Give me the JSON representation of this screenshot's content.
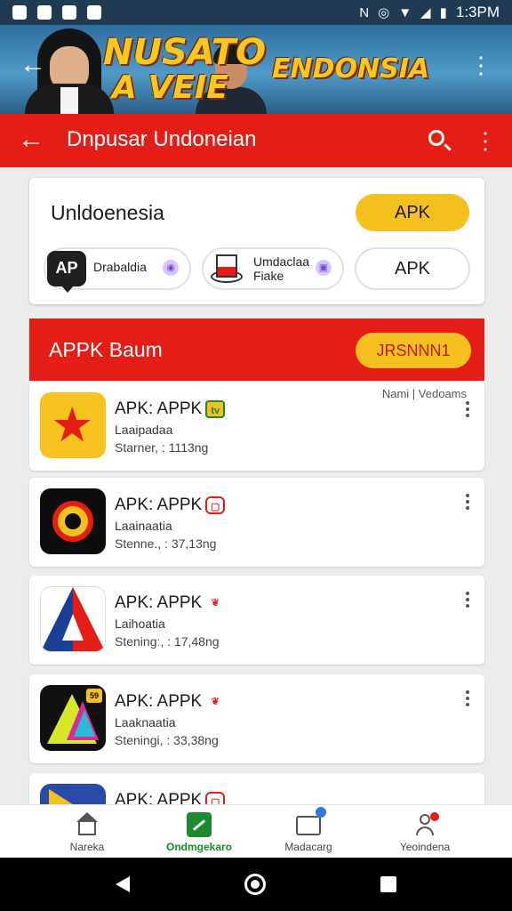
{
  "status_bar": {
    "time": "1:3PM",
    "left_icons": [
      "notification-icon",
      "notification-icon",
      "notification-icon",
      "notification-icon"
    ],
    "right_icons": [
      "nfc-icon",
      "alarm-icon",
      "wifi-icon",
      "signal-icon",
      "battery-icon"
    ]
  },
  "banner": {
    "title_line1": "NUSATO",
    "title_line2": "A VEIE",
    "title_right": "ENDONSIA"
  },
  "app_bar": {
    "title": "Dnpusar Undoneian",
    "color": "#e41e16"
  },
  "info_card": {
    "title": "Unldoenesia",
    "apk_button": "APK",
    "chips": [
      {
        "icon_text": "AP",
        "label": "Drabaldia"
      },
      {
        "label_line1": "Umdaclaa",
        "label_line2": "Fiake"
      },
      {
        "label": "APK"
      }
    ]
  },
  "section": {
    "title": "APPK Baum",
    "button": "JRSNNN1",
    "sort_label": "Nami | Vedoams"
  },
  "apps": [
    {
      "name": "APK: APPK",
      "category": "Laaipadaa",
      "meta": "Starner, : 1113ng"
    },
    {
      "name": "APK: APPK",
      "category": "Laainaatia",
      "meta": "Stenne., : 37,13ng"
    },
    {
      "name": "APK: APPK",
      "category": "Laihoatia",
      "meta": "Steningː, : 17,48ng"
    },
    {
      "name": "APK: APPK",
      "category": "Laaknaatia",
      "meta": "Steningi, : 33,38ng"
    },
    {
      "name": "APK: APPK"
    }
  ],
  "bottom_nav": [
    {
      "label": "Nareka"
    },
    {
      "label": "Ondmgekaro"
    },
    {
      "label": "Madacarg"
    },
    {
      "label": "Yeoindena"
    }
  ],
  "colors": {
    "primary_red": "#e41e16",
    "accent_yellow": "#f4c01e",
    "active_green": "#1e8a2e"
  }
}
